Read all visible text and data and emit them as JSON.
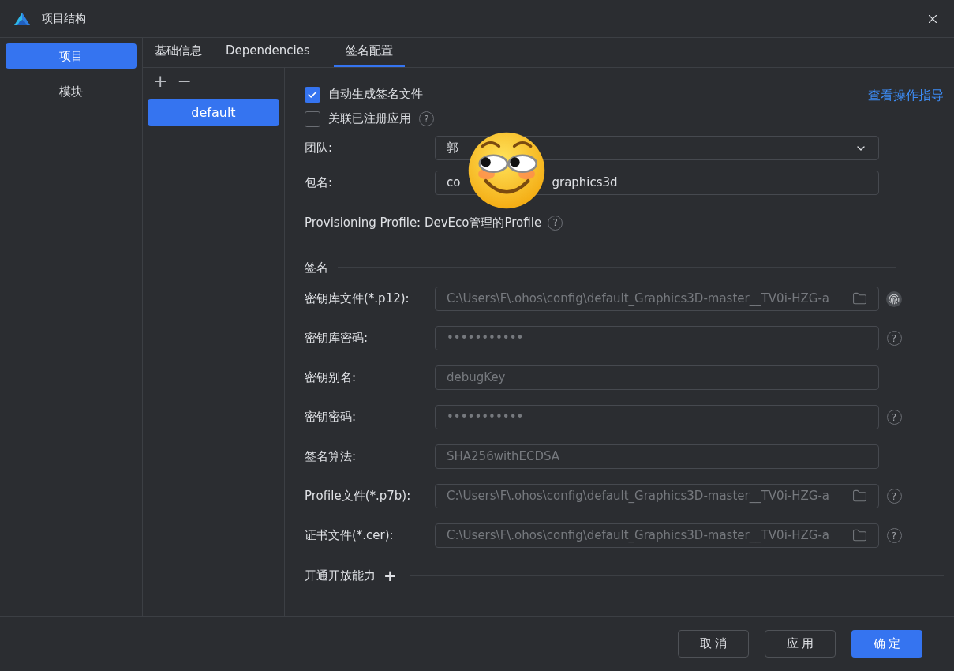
{
  "window": {
    "title": "项目结构"
  },
  "sidebar": {
    "items": [
      {
        "label": "项目",
        "selected": true
      },
      {
        "label": "模块",
        "selected": false
      }
    ]
  },
  "tabs": [
    {
      "label": "基础信息",
      "selected": false
    },
    {
      "label": "Dependencies",
      "selected": false
    },
    {
      "label": "签名配置",
      "selected": true
    }
  ],
  "configs": {
    "add": "+",
    "remove": "−",
    "items": [
      {
        "label": "default",
        "selected": true
      }
    ]
  },
  "signing": {
    "options": [
      {
        "label": "自动生成签名文件",
        "checked": true
      },
      {
        "label": "关联已注册应用",
        "checked": false,
        "help": "?"
      }
    ],
    "guide_link": "查看操作指导",
    "team": {
      "label": "团队:",
      "value": "郭"
    },
    "bundle": {
      "label": "包名:",
      "value_start": "co",
      "value_end": "graphics3d"
    },
    "profile_note": "Provisioning Profile: DevEco管理的Profile",
    "profile_help": "?",
    "section": "签名",
    "fields": [
      {
        "kind": "file",
        "label": "密钥库文件(*.p12):",
        "value": "C:\\Users\\F\\.ohos\\config\\default_Graphics3D-master__TV0i-HZG-a",
        "disabled": true,
        "fingerprint": true
      },
      {
        "kind": "password",
        "label": "密钥库密码:",
        "value": "•••••••••••",
        "disabled": true,
        "help": "?"
      },
      {
        "kind": "text",
        "label": "密钥别名:",
        "value": "debugKey",
        "disabled": true
      },
      {
        "kind": "password",
        "label": "密钥密码:",
        "value": "•••••••••••",
        "disabled": true,
        "help": "?"
      },
      {
        "kind": "text",
        "label": "签名算法:",
        "value": "SHA256withECDSA",
        "disabled": true
      },
      {
        "kind": "file",
        "label": "Profile文件(*.p7b):",
        "value": "C:\\Users\\F\\.ohos\\config\\default_Graphics3D-master__TV0i-HZG-a",
        "disabled": true,
        "help": "?"
      },
      {
        "kind": "file",
        "label": "证书文件(*.cer):",
        "value": "C:\\Users\\F\\.ohos\\config\\default_Graphics3D-master__TV0i-HZG-a",
        "disabled": true,
        "help": "?"
      }
    ],
    "capabilities": {
      "label": "开通开放能力",
      "add": "+"
    }
  },
  "buttons": [
    {
      "label": "取消",
      "kind": "secondary"
    },
    {
      "label": "应用",
      "kind": "secondary"
    },
    {
      "label": "确定",
      "kind": "primary"
    }
  ]
}
